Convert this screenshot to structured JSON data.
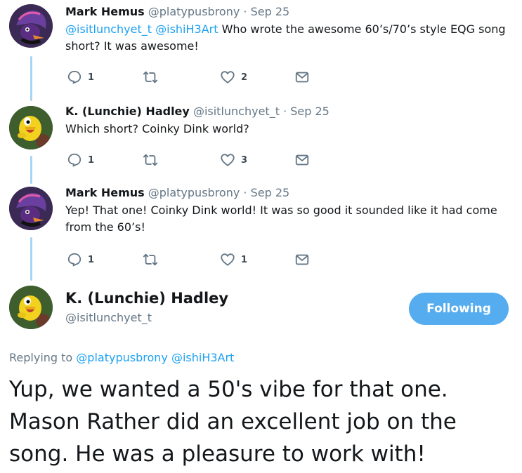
{
  "thread": [
    {
      "name": "Mark Hemus",
      "handle": "@platypusbrony",
      "separator": "·",
      "date": "Sep 25",
      "mentions": [
        "@isitlunchyet_t",
        "@ishiH3Art"
      ],
      "text": "Who wrote the awesome 60’s/70’s style EQG song short? It was awesome!",
      "replies": "1",
      "likes": "2"
    },
    {
      "name": "K. (Lunchie) Hadley",
      "handle": "@isitlunchyet_t",
      "separator": "·",
      "date": "Sep 25",
      "text": "Which short? Coinky Dink world?",
      "replies": "1",
      "likes": "3"
    },
    {
      "name": "Mark Hemus",
      "handle": "@platypusbrony",
      "separator": "·",
      "date": "Sep 25",
      "text": "Yep! That one! Coinky Dink world! It was so good it sounded like it had come from the 60’s!",
      "replies": "1",
      "likes": "1"
    }
  ],
  "focus": {
    "name": "K. (Lunchie) Hadley",
    "handle": "@isitlunchyet_t",
    "follow_label": "Following",
    "replying_prefix": "Replying to",
    "replying_mentions": [
      "@platypusbrony",
      "@ishiH3Art"
    ],
    "text": "Yup, we wanted a 50's vibe for that one. Mason Rather did an excellent job on the song. He was a pleasure to work with!"
  },
  "icons": {
    "reply": "reply-icon",
    "retweet": "retweet-icon",
    "like": "heart-icon",
    "dm": "envelope-icon"
  },
  "colors": {
    "link": "#1da1f2",
    "follow_button": "#55acee",
    "thread_line": "#a9d5f5",
    "secondary_text": "#657786"
  }
}
